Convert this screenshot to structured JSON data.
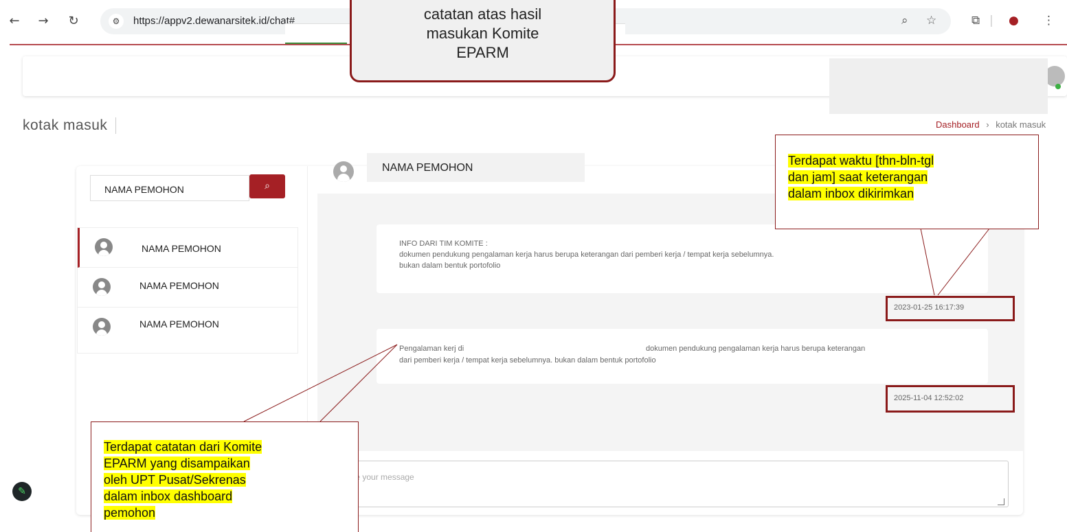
{
  "browser": {
    "url": "https://appv2.dewanarsitek.id/chat#"
  },
  "page": {
    "title": "kotak masuk",
    "breadcrumb": {
      "home": "Dashboard",
      "separator": "›",
      "current": "kotak masuk"
    }
  },
  "sidebar": {
    "search_value": "NAMA PEMOHON",
    "contacts": [
      {
        "name": "NAMA PEMOHON"
      },
      {
        "name": "NAMA PEMOHON"
      },
      {
        "name": "NAMA PEMOHON"
      }
    ]
  },
  "chat": {
    "contact_name": "NAMA PEMOHON",
    "messages": [
      {
        "line1": "INFO DARI TIM KOMITE :",
        "line2": "dokumen pendukung pengalaman kerja harus berupa keterangan dari pemberi kerja / tempat kerja sebelumnya.",
        "line3": "bukan dalam bentuk portofolio",
        "time": "2023-01-25 16:17:39"
      },
      {
        "line1a": "Pengalaman kerj di",
        "line1b": "dokumen pendukung pengalaman kerja harus berupa keterangan",
        "line2": "dari pemberi kerja / tempat kerja sebelumnya. bukan dalam bentuk portofolio",
        "time": "2025-11-04 12:52:02"
      }
    ],
    "input_placeholder": "Type your message"
  },
  "annotations": {
    "top": [
      "catatan atas hasil",
      "masukan Komite",
      "EPARM"
    ],
    "right": [
      "Terdapat waktu [thn-bln-tgl",
      "dan jam] saat keterangan",
      "dalam inbox dikirimkan"
    ],
    "left": [
      "Terdapat catatan dari Komite",
      "EPARM yang disampaikan",
      "oleh UPT Pusat/Sekrenas",
      "dalam inbox dashboard",
      "pemohon"
    ]
  },
  "colors": {
    "accent": "#a52025",
    "callout_border": "#8a1a1a",
    "highlight": "#ffff00"
  }
}
